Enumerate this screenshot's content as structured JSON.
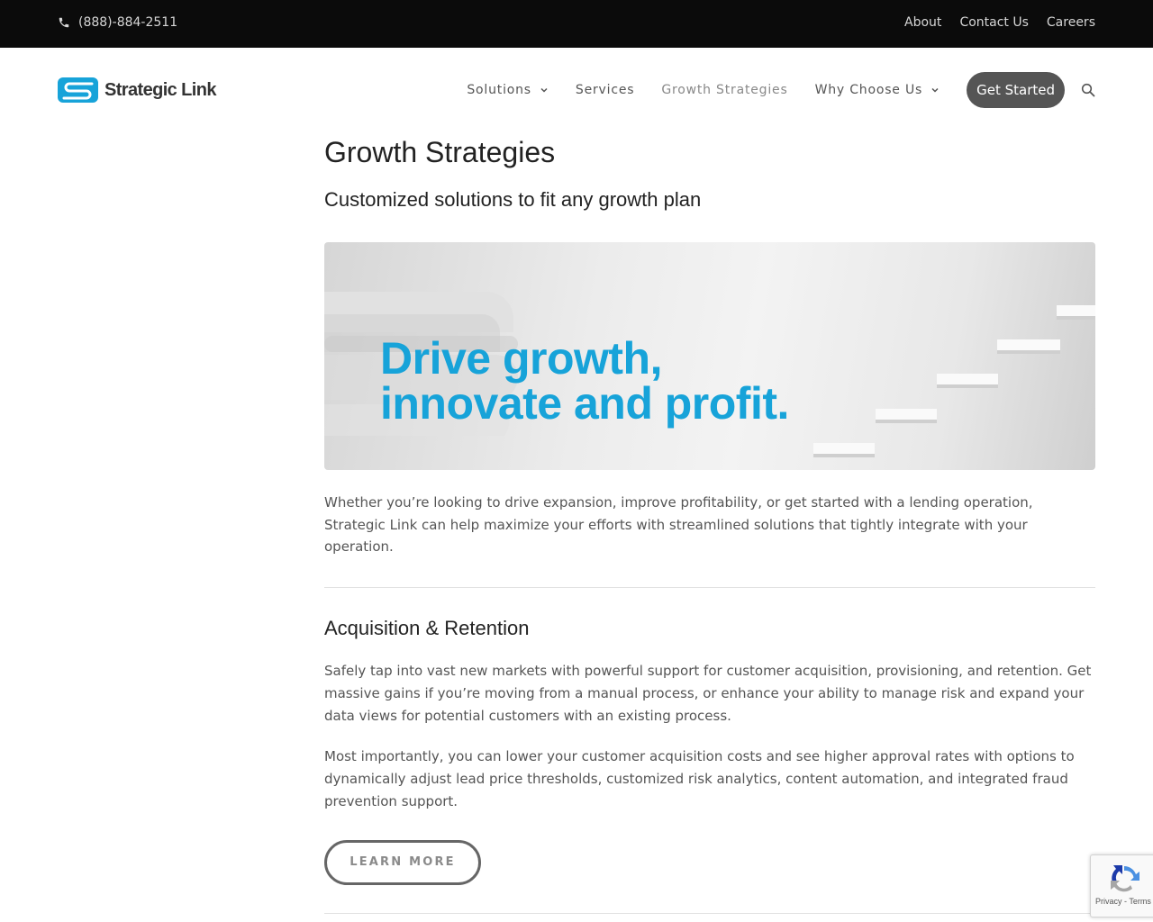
{
  "topbar": {
    "phone": "(888)-884-2511",
    "links": [
      "About",
      "Contact Us",
      "Careers"
    ]
  },
  "header": {
    "logo_text": "Strategic Link",
    "nav": [
      {
        "label": "Solutions",
        "has_dropdown": true
      },
      {
        "label": "Services",
        "has_dropdown": false
      },
      {
        "label": "Growth Strategies",
        "has_dropdown": false,
        "active": true
      },
      {
        "label": "Why Choose Us",
        "has_dropdown": true
      }
    ],
    "cta_label": "Get Started"
  },
  "main": {
    "title": "Growth Strategies",
    "subtitle": "Customized solutions to fit any growth plan",
    "hero": {
      "line1": "Drive growth,",
      "line2": "innovate and profit."
    },
    "intro": "Whether you’re looking to drive expansion, improve profitability, or get started with a lending operation, Strategic Link can help maximize your efforts with streamlined solutions that tightly integrate with your operation.",
    "section": {
      "title": "Acquisition & Retention",
      "para1": "Safely tap into vast new markets with powerful support for customer acquisition, provisioning, and retention. Get massive gains if you’re moving from a manual process, or enhance your ability to manage risk and expand your data views for potential customers with an existing process.",
      "para2": "Most importantly, you can lower your customer acquisition costs and see higher approval rates with options to dynamically adjust lead price thresholds, customized risk analytics, content automation, and integrated fraud prevention support.",
      "button_label": "LEARN MORE"
    }
  },
  "recaptcha": {
    "links": "Privacy - Terms"
  },
  "colors": {
    "topbar_bg": "#0b0b0b",
    "brand_blue": "#17a3d9",
    "cta_bg": "#555555"
  }
}
